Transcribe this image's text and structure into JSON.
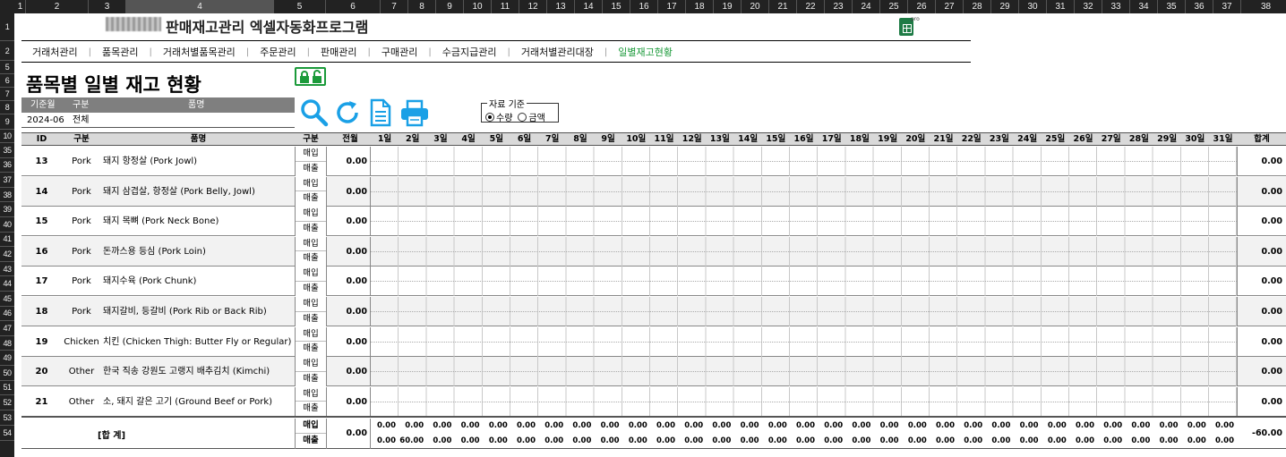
{
  "spreadsheet": {
    "col_headers": [
      "1",
      "2",
      "3",
      "4",
      "5",
      "6",
      "7",
      "8",
      "9",
      "10",
      "11",
      "12",
      "13",
      "14",
      "15",
      "16",
      "17",
      "18",
      "19",
      "20",
      "21",
      "22",
      "23",
      "24",
      "25",
      "26",
      "27",
      "28",
      "29",
      "30",
      "31",
      "32",
      "33",
      "34",
      "35",
      "36",
      "37",
      "38"
    ],
    "row_headers": [
      "1",
      "2",
      "5",
      "6",
      "7",
      "8",
      "9",
      "10",
      "35",
      "36",
      "37",
      "38",
      "39",
      "40",
      "41",
      "42",
      "43",
      "44",
      "45",
      "46",
      "47",
      "48",
      "49",
      "50",
      "51",
      "52",
      "53",
      "54"
    ]
  },
  "header": {
    "app_title": "판매재고관리 엑셀자동화프로그램",
    "excel_icon_label": "pro"
  },
  "nav": {
    "items": [
      "거래처관리",
      "품목관리",
      "거래처별품목관리",
      "주문관리",
      "판매관리",
      "구매관리",
      "수금지급관리",
      "거래처별관리대장",
      "일별재고현황"
    ],
    "active_index": 8
  },
  "page_title": "품목별 일별 재고 현황",
  "filter": {
    "headers": [
      "기준월",
      "구분",
      "품명"
    ],
    "values": [
      "2024-06",
      "전체",
      ""
    ]
  },
  "basis": {
    "legend": "자료 기준",
    "options": [
      "수량",
      "금액"
    ],
    "selected": "수량"
  },
  "table": {
    "headers": {
      "id": "ID",
      "category": "구분",
      "name": "품명",
      "kind": "구분",
      "prev_month": "전월",
      "total": "합계"
    },
    "days": [
      "1일",
      "2일",
      "3일",
      "4일",
      "5일",
      "6일",
      "7일",
      "8일",
      "9일",
      "10일",
      "11일",
      "12일",
      "13일",
      "14일",
      "15일",
      "16일",
      "17일",
      "18일",
      "19일",
      "20일",
      "21일",
      "22일",
      "23일",
      "24일",
      "25일",
      "26일",
      "27일",
      "28일",
      "29일",
      "30일",
      "31일"
    ],
    "kind_labels": [
      "매입",
      "매출"
    ],
    "rows": [
      {
        "id": "13",
        "category": "Pork",
        "name": "돼지 항정살 (Pork Jowl)",
        "prev": "0.00",
        "total": "0.00"
      },
      {
        "id": "14",
        "category": "Pork",
        "name": "돼지 삼겹살, 항정살 (Pork Belly, Jowl)",
        "prev": "0.00",
        "total": "0.00"
      },
      {
        "id": "15",
        "category": "Pork",
        "name": "돼지 목뼈 (Pork Neck Bone)",
        "prev": "0.00",
        "total": "0.00"
      },
      {
        "id": "16",
        "category": "Pork",
        "name": "돈까스용 등심 (Pork Loin)",
        "prev": "0.00",
        "total": "0.00"
      },
      {
        "id": "17",
        "category": "Pork",
        "name": "돼지수육 (Pork Chunk)",
        "prev": "0.00",
        "total": "0.00"
      },
      {
        "id": "18",
        "category": "Pork",
        "name": "돼지갈비, 등갈비 (Pork Rib or Back Rib)",
        "prev": "0.00",
        "total": "0.00"
      },
      {
        "id": "19",
        "category": "Chicken",
        "name": "치킨 (Chicken Thigh: Butter Fly or Regular)",
        "prev": "0.00",
        "total": "0.00"
      },
      {
        "id": "20",
        "category": "Other",
        "name": "한국 직송 강원도 고랭지 배추김치 (Kimchi)",
        "prev": "0.00",
        "total": "0.00"
      },
      {
        "id": "21",
        "category": "Other",
        "name": "소, 돼지 갈은 고기 (Ground Beef or Pork)",
        "prev": "0.00",
        "total": "0.00"
      }
    ],
    "summary": {
      "label": "[합 계]",
      "prev": "0.00",
      "total": "-60.00",
      "purchase": [
        "0.00",
        "0.00",
        "0.00",
        "0.00",
        "0.00",
        "0.00",
        "0.00",
        "0.00",
        "0.00",
        "0.00",
        "0.00",
        "0.00",
        "0.00",
        "0.00",
        "0.00",
        "0.00",
        "0.00",
        "0.00",
        "0.00",
        "0.00",
        "0.00",
        "0.00",
        "0.00",
        "0.00",
        "0.00",
        "0.00",
        "0.00",
        "0.00",
        "0.00",
        "0.00",
        "0.00"
      ],
      "sales": [
        "0.00",
        "60.00",
        "0.00",
        "0.00",
        "0.00",
        "0.00",
        "0.00",
        "0.00",
        "0.00",
        "0.00",
        "0.00",
        "0.00",
        "0.00",
        "0.00",
        "0.00",
        "0.00",
        "0.00",
        "0.00",
        "0.00",
        "0.00",
        "0.00",
        "0.00",
        "0.00",
        "0.00",
        "0.00",
        "0.00",
        "0.00",
        "0.00",
        "0.00",
        "0.00",
        "0.00"
      ]
    }
  },
  "toolbar": {
    "icons": [
      "search-icon",
      "refresh-icon",
      "document-icon",
      "print-icon",
      "lock-icon"
    ]
  },
  "colors": {
    "accent_green": "#1b9a3a",
    "icon_blue": "#1aa0e6",
    "header_gray": "#7f7f7f"
  }
}
